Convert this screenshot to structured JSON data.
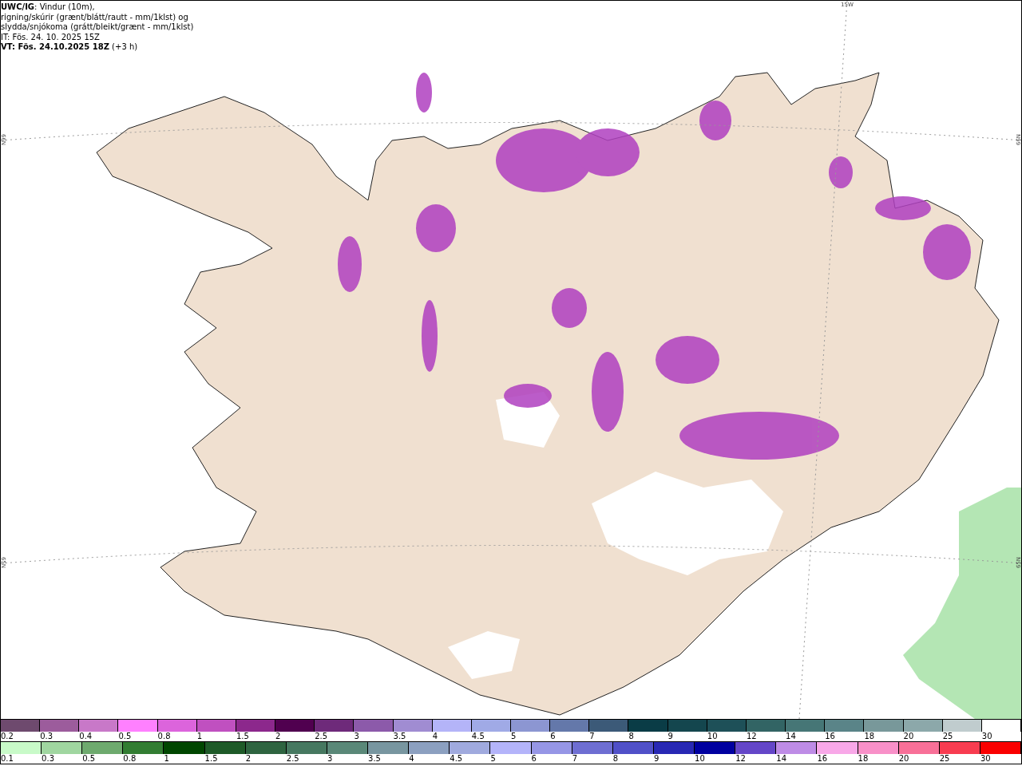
{
  "header": {
    "model": "UWC/IG",
    "description": ": Vindur (10m),",
    "lines": [
      "rigning/skúrir (grænt/blátt/rautt - mm/1klst) og",
      "slydda/snjókoma (grátt/bleikt/grænt - mm/1klst)",
      "IT: Fös. 24. 10. 2025 15Z"
    ],
    "valid_time": "VT: Fös. 24.10.2025 18Z",
    "lead": " (+3 h)"
  },
  "map": {
    "graticule_labels": [
      {
        "kind": "lon",
        "text": "15W"
      },
      {
        "kind": "lat-left",
        "text": "66N"
      },
      {
        "kind": "lat-right",
        "text": "66N"
      },
      {
        "kind": "lat-left",
        "text": "65N"
      },
      {
        "kind": "lat-right",
        "text": "65N"
      }
    ]
  },
  "legends": [
    {
      "items": [
        {
          "label": "0.2",
          "color": "#6e4a6e"
        },
        {
          "label": "0.3",
          "color": "#9c5c9c"
        },
        {
          "label": "0.4",
          "color": "#c878c8"
        },
        {
          "label": "0.5",
          "color": "#ff80ff"
        },
        {
          "label": "0.8",
          "color": "#dc64dc"
        },
        {
          "label": "1",
          "color": "#c050c0"
        },
        {
          "label": "1.5",
          "color": "#8c288c"
        },
        {
          "label": "2",
          "color": "#50004f"
        },
        {
          "label": "2.5",
          "color": "#6e2a7a"
        },
        {
          "label": "3",
          "color": "#8c5aaa"
        },
        {
          "label": "3.5",
          "color": "#a08cd2"
        },
        {
          "label": "4",
          "color": "#b4b4f8"
        },
        {
          "label": "4.5",
          "color": "#a0aae6"
        },
        {
          "label": "5",
          "color": "#8c96d2"
        },
        {
          "label": "6",
          "color": "#6478aa"
        },
        {
          "label": "7",
          "color": "#3c5a78"
        },
        {
          "label": "8",
          "color": "#0a3c46"
        },
        {
          "label": "9",
          "color": "#14464e"
        },
        {
          "label": "10",
          "color": "#1e5058"
        },
        {
          "label": "12",
          "color": "#326464"
        },
        {
          "label": "14",
          "color": "#467676"
        },
        {
          "label": "16",
          "color": "#5a8488"
        },
        {
          "label": "18",
          "color": "#78989a"
        },
        {
          "label": "20",
          "color": "#8ca8aa"
        },
        {
          "label": "25",
          "color": "#c0ccce"
        },
        {
          "label": "30",
          "color": "#ffffff"
        }
      ]
    },
    {
      "items": [
        {
          "label": "0.1",
          "color": "#c8fac8"
        },
        {
          "label": "0.3",
          "color": "#a0d6a0"
        },
        {
          "label": "0.5",
          "color": "#6eaa6e"
        },
        {
          "label": "0.8",
          "color": "#327d32"
        },
        {
          "label": "1",
          "color": "#004600"
        },
        {
          "label": "1.5",
          "color": "#1e5a28"
        },
        {
          "label": "2",
          "color": "#2e6440"
        },
        {
          "label": "2.5",
          "color": "#467860"
        },
        {
          "label": "3",
          "color": "#5a8878"
        },
        {
          "label": "3.5",
          "color": "#7896a0"
        },
        {
          "label": "4",
          "color": "#8ca0c0"
        },
        {
          "label": "4.5",
          "color": "#a0aade"
        },
        {
          "label": "5",
          "color": "#b4b4fa"
        },
        {
          "label": "6",
          "color": "#9696e6"
        },
        {
          "label": "7",
          "color": "#6e6ed2"
        },
        {
          "label": "8",
          "color": "#5050c8"
        },
        {
          "label": "9",
          "color": "#2828b4"
        },
        {
          "label": "10",
          "color": "#0000a0"
        },
        {
          "label": "12",
          "color": "#6446c8"
        },
        {
          "label": "14",
          "color": "#be8ce6"
        },
        {
          "label": "16",
          "color": "#f8a8e8"
        },
        {
          "label": "18",
          "color": "#f890c8"
        },
        {
          "label": "20",
          "color": "#f87098"
        },
        {
          "label": "25",
          "color": "#f83c50"
        },
        {
          "label": "30",
          "color": "#fa0000"
        }
      ]
    }
  ]
}
